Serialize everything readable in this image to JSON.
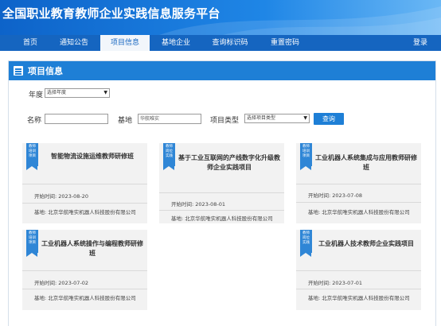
{
  "header": {
    "title": "全国职业教育教师企业实践信息服务平台"
  },
  "nav": {
    "items": [
      "首页",
      "通知公告",
      "项目信息",
      "基地企业",
      "查询标识码",
      "重置密码"
    ],
    "active_index": 2,
    "login": "登录"
  },
  "panel": {
    "title": "项目信息"
  },
  "filters": {
    "year_label": "年度",
    "year_select": "选择年度",
    "name_label": "名称",
    "name_value": "",
    "base_label": "基地",
    "base_value": "华航唯实",
    "type_label": "项目类型",
    "type_select": "选择项目类型",
    "query_button": "查询"
  },
  "card_fields": {
    "start_prefix": "开始时间:",
    "base_prefix": "基地:"
  },
  "projects": [
    {
      "ribbon": "教师\n培训\n项目",
      "title": "智能物流设施运维教师研修班",
      "start": "2023-08-20",
      "base": "北京华航唯实机器人科技股份有限公司"
    },
    {
      "ribbon": "教师\n岗位\n实践",
      "title": "基于工业互联网的产线数字化升级教师企业实践项目",
      "start": "2023-08-01",
      "base": "北京华航唯实机器人科技股份有限公司"
    },
    {
      "ribbon": "教师\n培训\n项目",
      "title": "工业机器人系统集成与应用教师研修班",
      "start": "2023-07-08",
      "base": "北京华航唯实机器人科技股份有限公司"
    },
    {
      "ribbon": "教师\n培训\n项目",
      "title": "工业机器人系统操作与编程教师研修班",
      "start": "2023-07-02",
      "base": "北京华航唯实机器人科技股份有限公司"
    },
    {
      "ribbon": "教师\n岗位\n实践",
      "title": "工业机器人技术教师企业实践项目",
      "start": "2023-07-01",
      "base": "北京华航唯实机器人科技股份有限公司"
    }
  ],
  "colors": {
    "primary": "#1565c0",
    "accent": "#1e7fd6",
    "card_bg": "#f2f2f2"
  }
}
